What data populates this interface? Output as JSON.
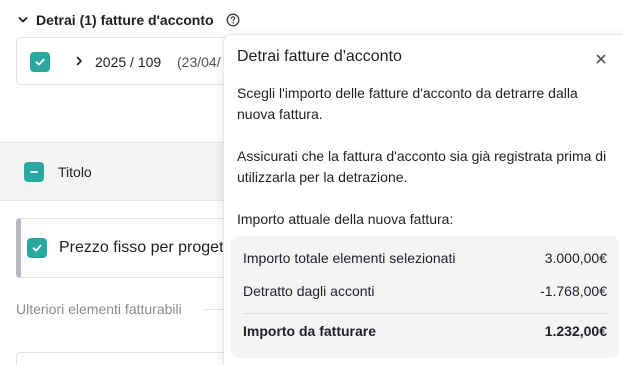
{
  "section": {
    "title": "Detrai (1) fatture d'acconto"
  },
  "invoice": {
    "number": "2025 / 109",
    "date": "(23/04/"
  },
  "table": {
    "column_title": "Titolo"
  },
  "item": {
    "label": "Prezzo fisso per progetto"
  },
  "further": {
    "label": "Ulteriori elementi fatturabili"
  },
  "popover": {
    "title": "Detrai fatture d'acconto",
    "paragraph1": "Scegli l'importo delle fatture d'acconto da detrarre dalla nuova fattura.",
    "paragraph2": "Assicurati che la fattura d'acconto sia già registrata prima di utilizzarla per la detrazione.",
    "paragraph3": "Importo attuale della nuova fattura:",
    "summary": {
      "rows": [
        {
          "label": "Importo totale elementi selezionati",
          "value": "3.000,00€"
        },
        {
          "label": "Detratto dagli acconti",
          "value": "-1.768,00€"
        },
        {
          "label": "Importo da fatturare",
          "value": "1.232,00€"
        }
      ]
    }
  },
  "colors": {
    "accent": "#2aa8a0",
    "panel_bg": "#f4f4f6"
  },
  "icons": [
    "chevron-down-icon",
    "help-icon",
    "checkbox-checked-icon",
    "chevron-right-icon",
    "checkbox-indeterminate-icon",
    "close-icon"
  ]
}
